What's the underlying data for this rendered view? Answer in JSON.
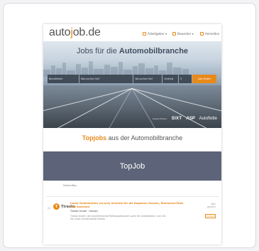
{
  "site": {
    "logo_prefix": "auto",
    "logo_accent": "j",
    "logo_suffix": "ob.de",
    "nav": [
      "Arbeitgeber ▾",
      "Bewerber ▾",
      "Anmelden"
    ]
  },
  "hero": {
    "title_prefix": "Jobs für die ",
    "title_bold": "Automobilbranche",
    "search_fields": [
      "Berufsfelder",
      "Was suchen Sie?",
      "Wo suchen Sie?",
      "Umkreis",
      "0"
    ],
    "search_button": "Jobs finden",
    "brands": [
      "Unsere Partner:",
      "SIXT",
      "ASP",
      "Autoflotte"
    ]
  },
  "topjobs": {
    "accent": "Topjobs",
    "rest": " aus der Automobilbranche"
  },
  "overlay": {
    "label": "TopJob"
  },
  "listing1": {
    "text": "Partner/Neu"
  },
  "listing2": {
    "number": "01",
    "logo_letter": "T",
    "logo_text": "Tiresto",
    "title": "Junior Gebietsleiter (m/w/d) Vertrieb für die Regionen Hessen, Rheinland-Pfalz und Saarland",
    "company": "Tiresto GmbH · Hessen",
    "description": "Tiresto GmbH, der marktführende Reifengroßhandel sucht für Gebietsleiter, zum Ort die unser Kundendienst Winter",
    "right_top": "Neu",
    "right_date": "gestern",
    "tag": "Vollzeit"
  },
  "colors": {
    "accent": "#e88a1a",
    "overlay_bg": "#5d6479"
  }
}
